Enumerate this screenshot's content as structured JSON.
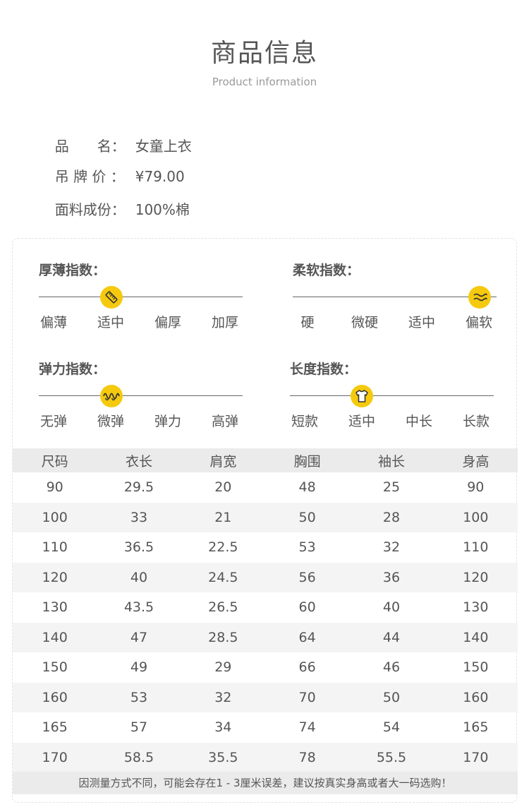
{
  "header": {
    "title": "商品信息",
    "subtitle": "Product information"
  },
  "info": [
    {
      "label": "品　　名：",
      "value": "女童上衣"
    },
    {
      "label": "吊 牌 价 ：",
      "value": "¥79.00"
    },
    {
      "label": "面料成份：",
      "value": "100%棉"
    }
  ],
  "indices": [
    {
      "title": "厚薄指数：",
      "options": [
        "偏薄",
        "适中",
        "偏厚",
        "加厚"
      ],
      "selected_index": 1,
      "icon": "ruler-icon"
    },
    {
      "title": "柔软指数：",
      "options": [
        "硬",
        "微硬",
        "适中",
        "偏软"
      ],
      "selected_index": 3,
      "icon": "wave-icon"
    },
    {
      "title": "弹力指数：",
      "options": [
        "无弹",
        "微弹",
        "弹力",
        "高弹"
      ],
      "selected_index": 1,
      "icon": "spring-icon"
    },
    {
      "title": "长度指数：",
      "options": [
        "短款",
        "适中",
        "中长",
        "长款"
      ],
      "selected_index": 1,
      "icon": "tshirt-icon"
    }
  ],
  "size_table": {
    "headers": [
      "尺码",
      "衣长",
      "肩宽",
      "胸围",
      "袖长",
      "身高"
    ],
    "rows": [
      [
        "90",
        "29.5",
        "20",
        "48",
        "25",
        "90"
      ],
      [
        "100",
        "33",
        "21",
        "50",
        "28",
        "100"
      ],
      [
        "110",
        "36.5",
        "22.5",
        "53",
        "32",
        "110"
      ],
      [
        "120",
        "40",
        "24.5",
        "56",
        "36",
        "120"
      ],
      [
        "130",
        "43.5",
        "26.5",
        "60",
        "40",
        "130"
      ],
      [
        "140",
        "47",
        "28.5",
        "64",
        "44",
        "140"
      ],
      [
        "150",
        "49",
        "29",
        "66",
        "46",
        "150"
      ],
      [
        "160",
        "53",
        "32",
        "70",
        "50",
        "160"
      ],
      [
        "165",
        "57",
        "34",
        "74",
        "54",
        "165"
      ],
      [
        "170",
        "58.5",
        "35.5",
        "78",
        "55.5",
        "170"
      ]
    ]
  },
  "note": "因测量方式不同，可能会存在1 - 3厘米误差，建议按真实身高或者大一码选购！",
  "colors": {
    "accent": "#f5c90e",
    "text": "#555555",
    "header_row": "#ebebeb",
    "stripe": "#f4f4f4"
  }
}
